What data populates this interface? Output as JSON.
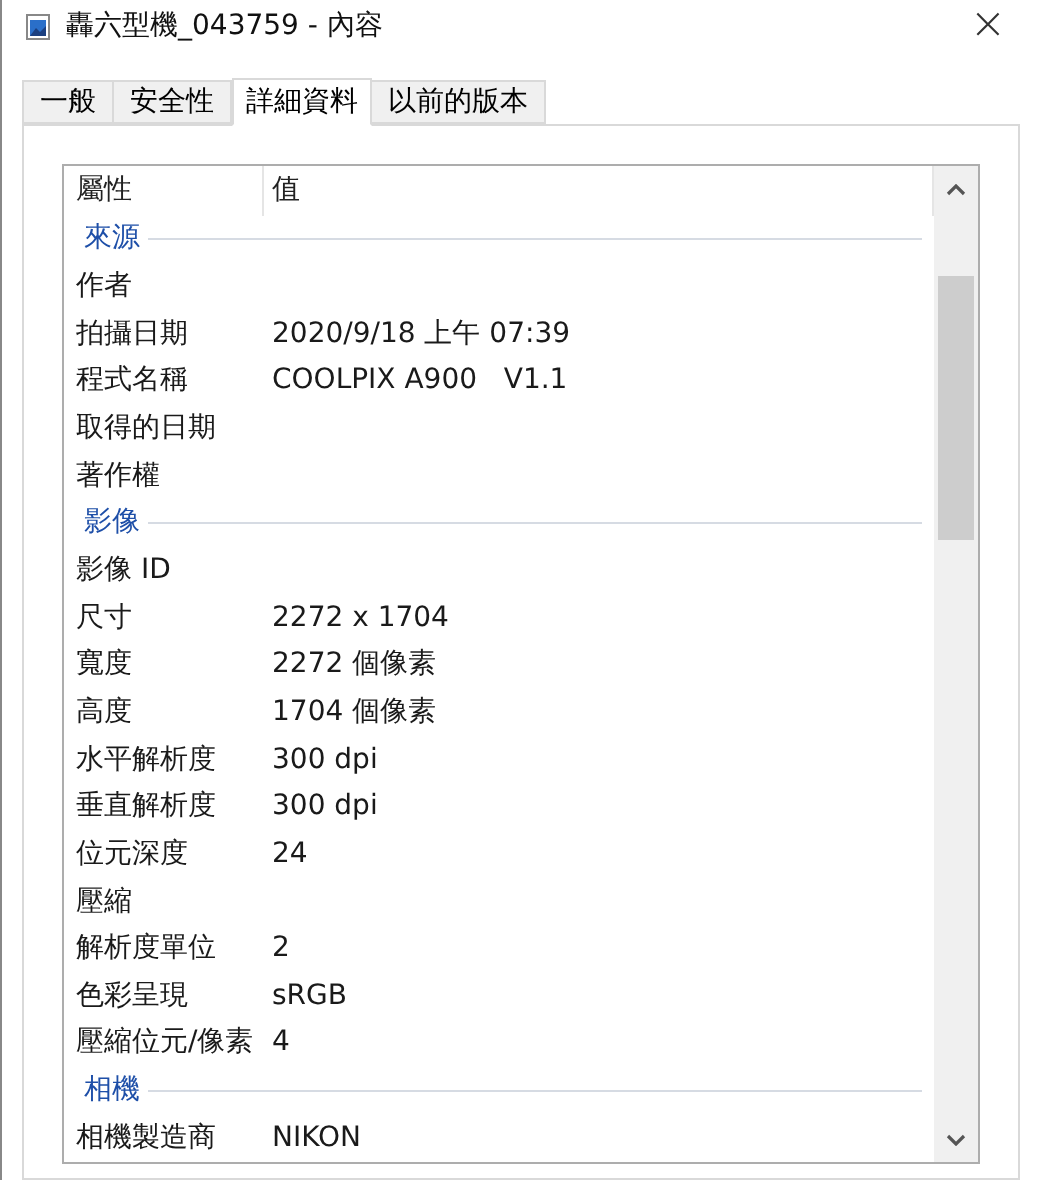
{
  "window": {
    "title": "轟六型機_043759 - 內容",
    "close": "×"
  },
  "tabs": [
    {
      "label": "一般",
      "selected": false
    },
    {
      "label": "安全性",
      "selected": false
    },
    {
      "label": "詳細資料",
      "selected": true
    },
    {
      "label": "以前的版本",
      "selected": false
    }
  ],
  "table": {
    "columns": [
      "屬性",
      "值"
    ],
    "rows": [
      {
        "kind": "group",
        "name": "來源"
      },
      {
        "kind": "property",
        "name": "作者"
      },
      {
        "kind": "property",
        "name": "拍攝日期",
        "value": "2020/9/18 上午 07:39"
      },
      {
        "kind": "property",
        "name": "程式名稱",
        "value": "COOLPIX A900   V1.1"
      },
      {
        "kind": "property",
        "name": "取得的日期"
      },
      {
        "kind": "property",
        "name": "著作權"
      },
      {
        "kind": "group",
        "name": "影像"
      },
      {
        "kind": "property",
        "name": "影像 ID"
      },
      {
        "kind": "property",
        "name": "尺寸",
        "value": "2272 x 1704"
      },
      {
        "kind": "property",
        "name": "寬度",
        "value": "2272 個像素"
      },
      {
        "kind": "property",
        "name": "高度",
        "value": "1704 個像素"
      },
      {
        "kind": "property",
        "name": "水平解析度",
        "value": "300 dpi"
      },
      {
        "kind": "property",
        "name": "垂直解析度",
        "value": "300 dpi"
      },
      {
        "kind": "property",
        "name": "位元深度",
        "value": "24"
      },
      {
        "kind": "property",
        "name": "壓縮"
      },
      {
        "kind": "property",
        "name": "解析度單位",
        "value": "2"
      },
      {
        "kind": "property",
        "name": "色彩呈現",
        "value": "sRGB"
      },
      {
        "kind": "property",
        "name": "壓縮位元/像素",
        "value": "4"
      },
      {
        "kind": "group",
        "name": "相機"
      },
      {
        "kind": "property",
        "name": "相機製造商",
        "value": "NIKON"
      }
    ]
  }
}
